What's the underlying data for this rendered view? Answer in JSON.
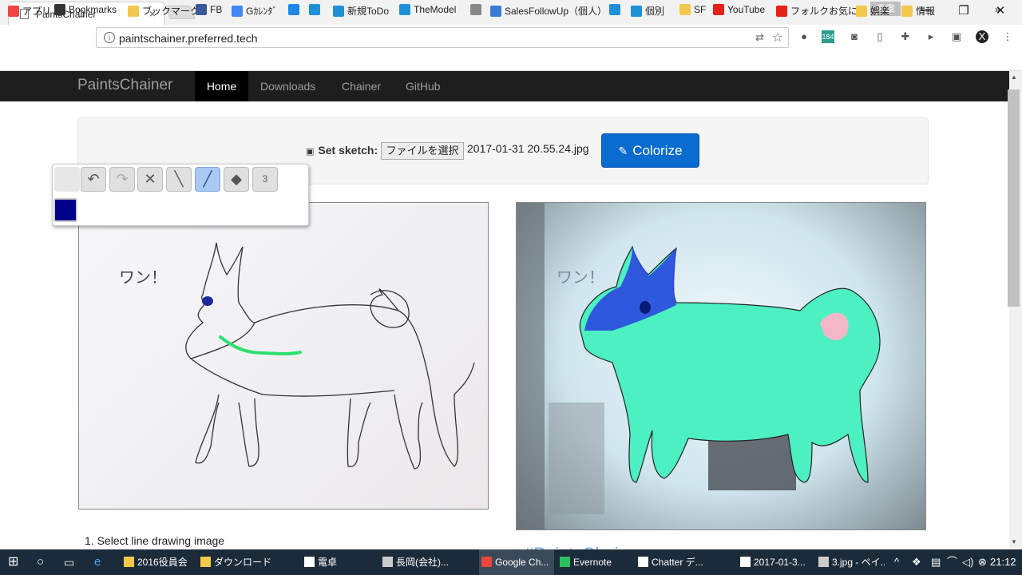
{
  "browser": {
    "tab_title": "PaintsChainer",
    "tab_close": "×",
    "ime_label": "香章",
    "window_buttons": {
      "minimize": "—",
      "maximize": "❐",
      "close": "✕"
    },
    "url": "paintschainer.preferred.tech"
  },
  "bookmarks": [
    {
      "label": "アプリ",
      "icon": "apps-grid-icon",
      "color": "#e44"
    },
    {
      "label": "Bookmarks",
      "icon": "star-icon",
      "color": "#333"
    },
    {
      "label": "ブックマーク",
      "icon": "folder-icon",
      "color": "#f2c94c"
    },
    {
      "label": "FB",
      "icon": "facebook-icon",
      "color": "#3b5998"
    },
    {
      "label": "Gｶﾚﾝﾀﾞ",
      "icon": "calendar-icon",
      "color": "#4285f4"
    },
    {
      "label": "",
      "icon": "p-icon",
      "color": "#1e88e5"
    },
    {
      "label": "",
      "icon": "cloud-icon",
      "color": "#1e90d8"
    },
    {
      "label": "新規ToDo",
      "icon": "cloud-icon",
      "color": "#1e90d8"
    },
    {
      "label": "TheModel",
      "icon": "cloud-icon",
      "color": "#1e90d8"
    },
    {
      "label": "",
      "icon": "page-icon",
      "color": "#888"
    },
    {
      "label": "SalesFollowUp（個人）",
      "icon": "runner-icon",
      "color": "#3a7bd5"
    },
    {
      "label": "",
      "icon": "cloud-icon",
      "color": "#1e90d8"
    },
    {
      "label": "個別",
      "icon": "cloud-icon",
      "color": "#1e90d8"
    },
    {
      "label": "SF",
      "icon": "folder-icon",
      "color": "#f2c94c"
    },
    {
      "label": "YouTube",
      "icon": "youtube-icon",
      "color": "#e62117"
    },
    {
      "label": "フォルクお気に",
      "icon": "youtube-icon",
      "color": "#e62117"
    },
    {
      "label": "娯楽",
      "icon": "folder-icon",
      "color": "#f2c94c"
    },
    {
      "label": "情報",
      "icon": "folder-icon",
      "color": "#f2c94c"
    }
  ],
  "bookmarks_more": "»",
  "site": {
    "brand": "PaintsChainer",
    "nav": [
      {
        "label": "Home",
        "active": true
      },
      {
        "label": "Downloads",
        "active": false
      },
      {
        "label": "Chainer",
        "active": false
      },
      {
        "label": "GitHub",
        "active": false
      }
    ],
    "set_sketch_label": "Set sketch:",
    "file_button": "ファイルを選択",
    "file_name": "2017-01-31 20.55.24.jpg",
    "colorize_button": "Colorize",
    "pen_size": "3",
    "pen_color": "#00008b",
    "sketch_text": "ワン！",
    "step1": "1. Select line drawing image",
    "heading_peek": "#PaintsChainer"
  },
  "taskbar": {
    "items": [
      {
        "label": "2016役員会",
        "color": "#f2c94c"
      },
      {
        "label": "ダウンロード",
        "color": "#f2c94c"
      },
      {
        "label": "電卓",
        "color": "#fff"
      },
      {
        "label": "長岡(会社)...",
        "color": "#ccc"
      },
      {
        "label": "Google Ch...",
        "color": "#e8453c"
      },
      {
        "label": "Evernote",
        "color": "#2dbe60"
      },
      {
        "label": "Chatter デ...",
        "color": "#fff"
      },
      {
        "label": "2017-01-3...",
        "color": "#fff"
      },
      {
        "label": "3.jpg - ペイ...",
        "color": "#ccc"
      }
    ],
    "clock": "21:12"
  }
}
